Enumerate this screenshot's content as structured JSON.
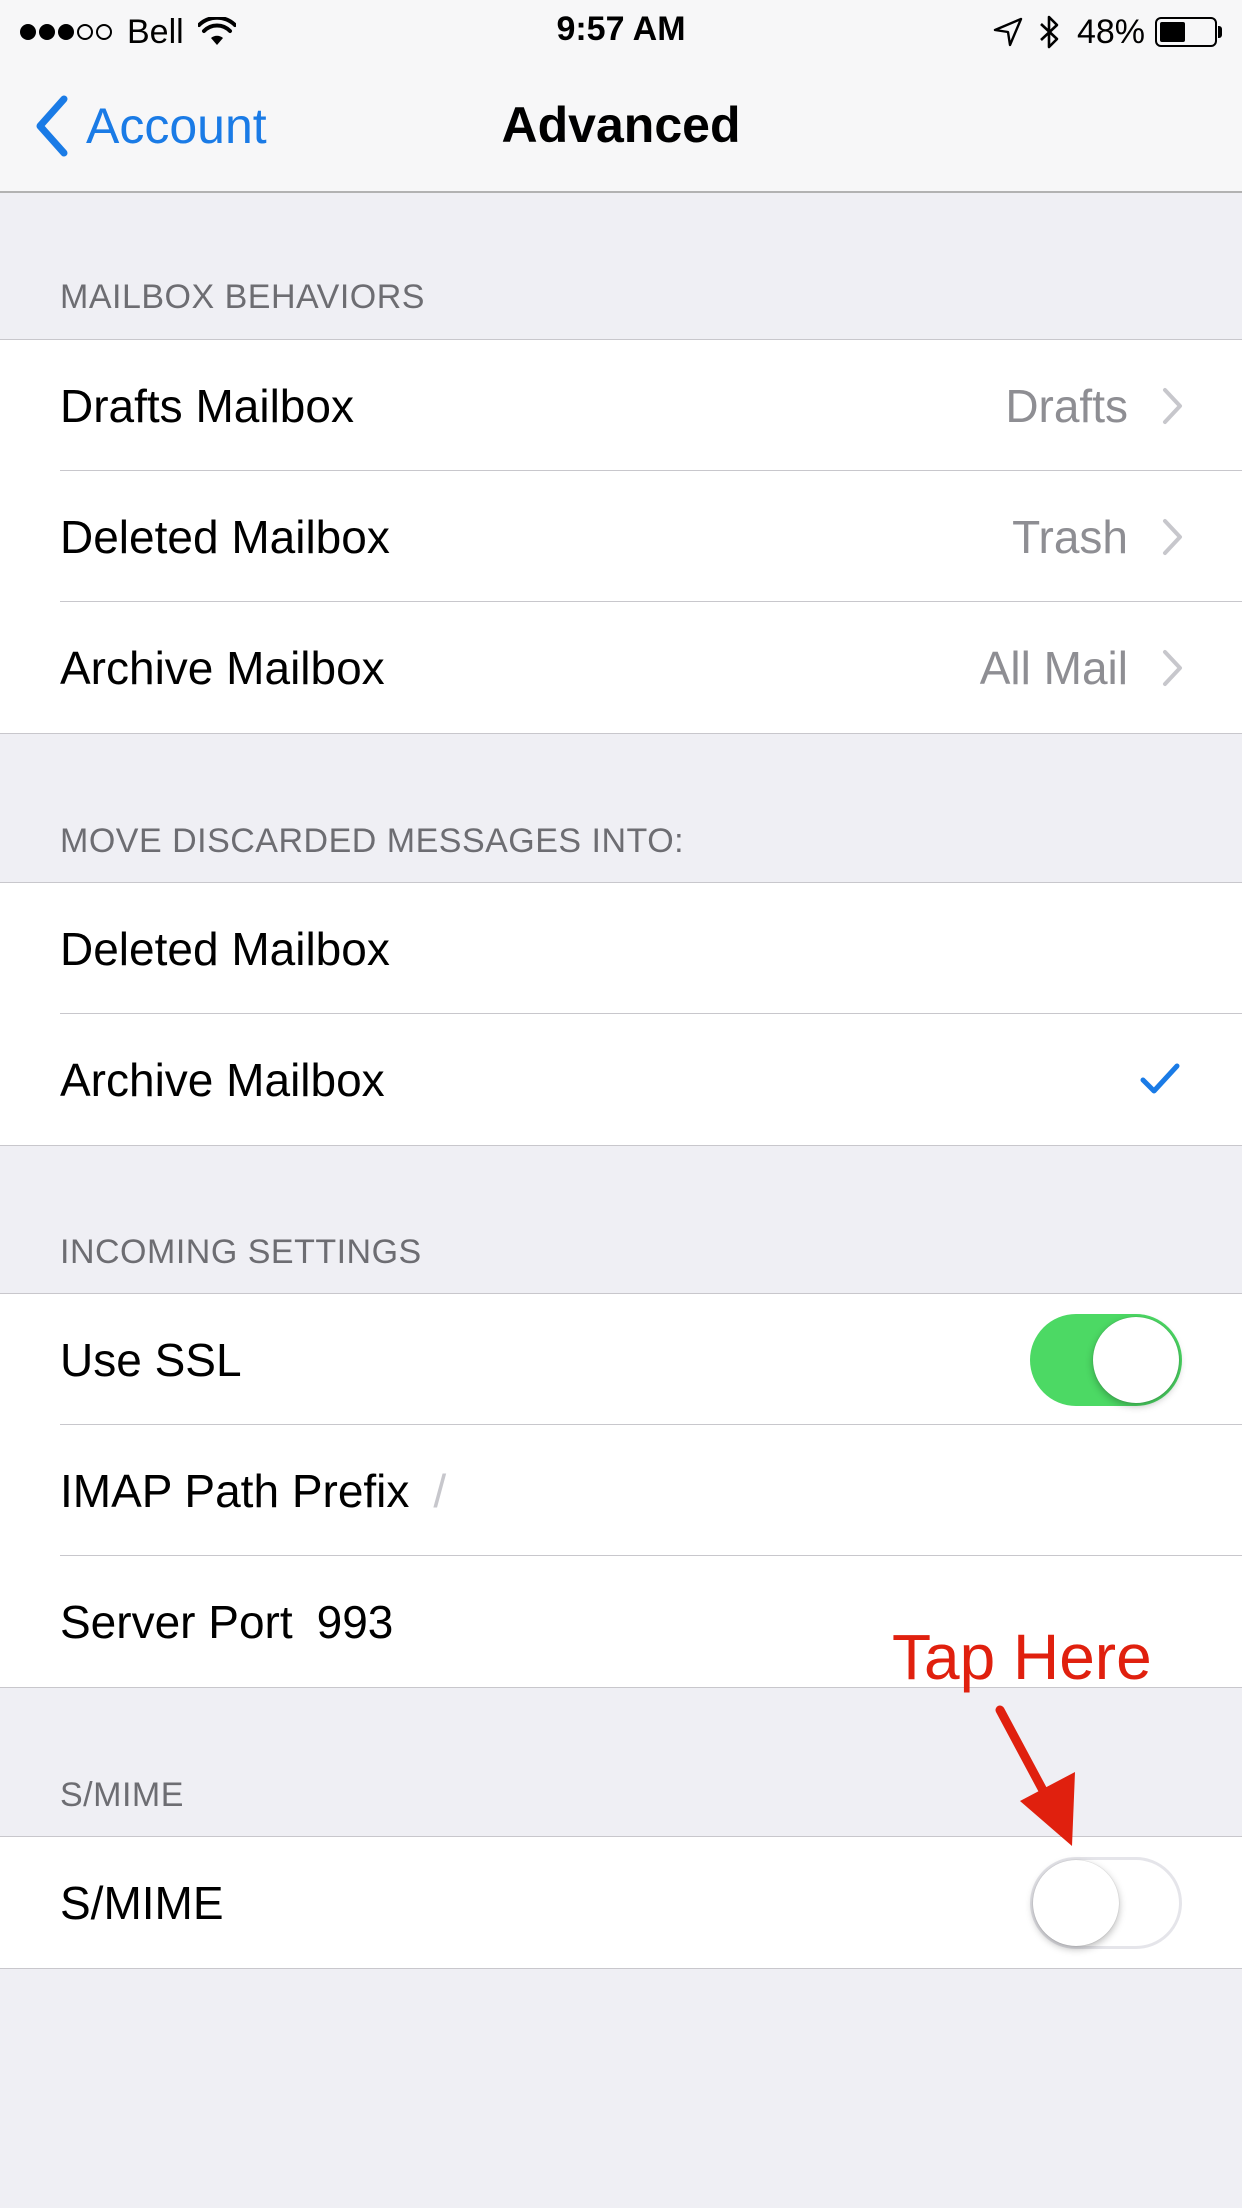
{
  "status_bar": {
    "carrier": "Bell",
    "time": "9:57 AM",
    "battery_percent": "48%",
    "battery_level": 0.48
  },
  "nav": {
    "back_label": "Account",
    "title": "Advanced"
  },
  "sections": {
    "mailbox_behaviors": {
      "header": "MAILBOX BEHAVIORS",
      "rows": [
        {
          "label": "Drafts Mailbox",
          "value": "Drafts"
        },
        {
          "label": "Deleted Mailbox",
          "value": "Trash"
        },
        {
          "label": "Archive Mailbox",
          "value": "All Mail"
        }
      ]
    },
    "move_discarded": {
      "header": "MOVE DISCARDED MESSAGES INTO:",
      "rows": [
        {
          "label": "Deleted Mailbox",
          "selected": false
        },
        {
          "label": "Archive Mailbox",
          "selected": true
        }
      ]
    },
    "incoming": {
      "header": "INCOMING SETTINGS",
      "use_ssl": {
        "label": "Use SSL",
        "on": true
      },
      "imap_prefix": {
        "label": "IMAP Path Prefix",
        "value": "/"
      },
      "server_port": {
        "label": "Server Port",
        "value": "993"
      }
    },
    "smime": {
      "header": "S/MIME",
      "toggle": {
        "label": "S/MIME",
        "on": false
      }
    }
  },
  "annotation": {
    "text": "Tap Here",
    "color": "#e0200e"
  },
  "colors": {
    "accent": "#1a7be6",
    "toggle_on": "#4cd964",
    "background": "#efeff4"
  },
  "icons": [
    "back-chevron-icon",
    "wifi-icon",
    "location-arrow-icon",
    "bluetooth-icon",
    "battery-icon",
    "chevron-right-icon",
    "checkmark-icon",
    "red-arrow-icon"
  ]
}
